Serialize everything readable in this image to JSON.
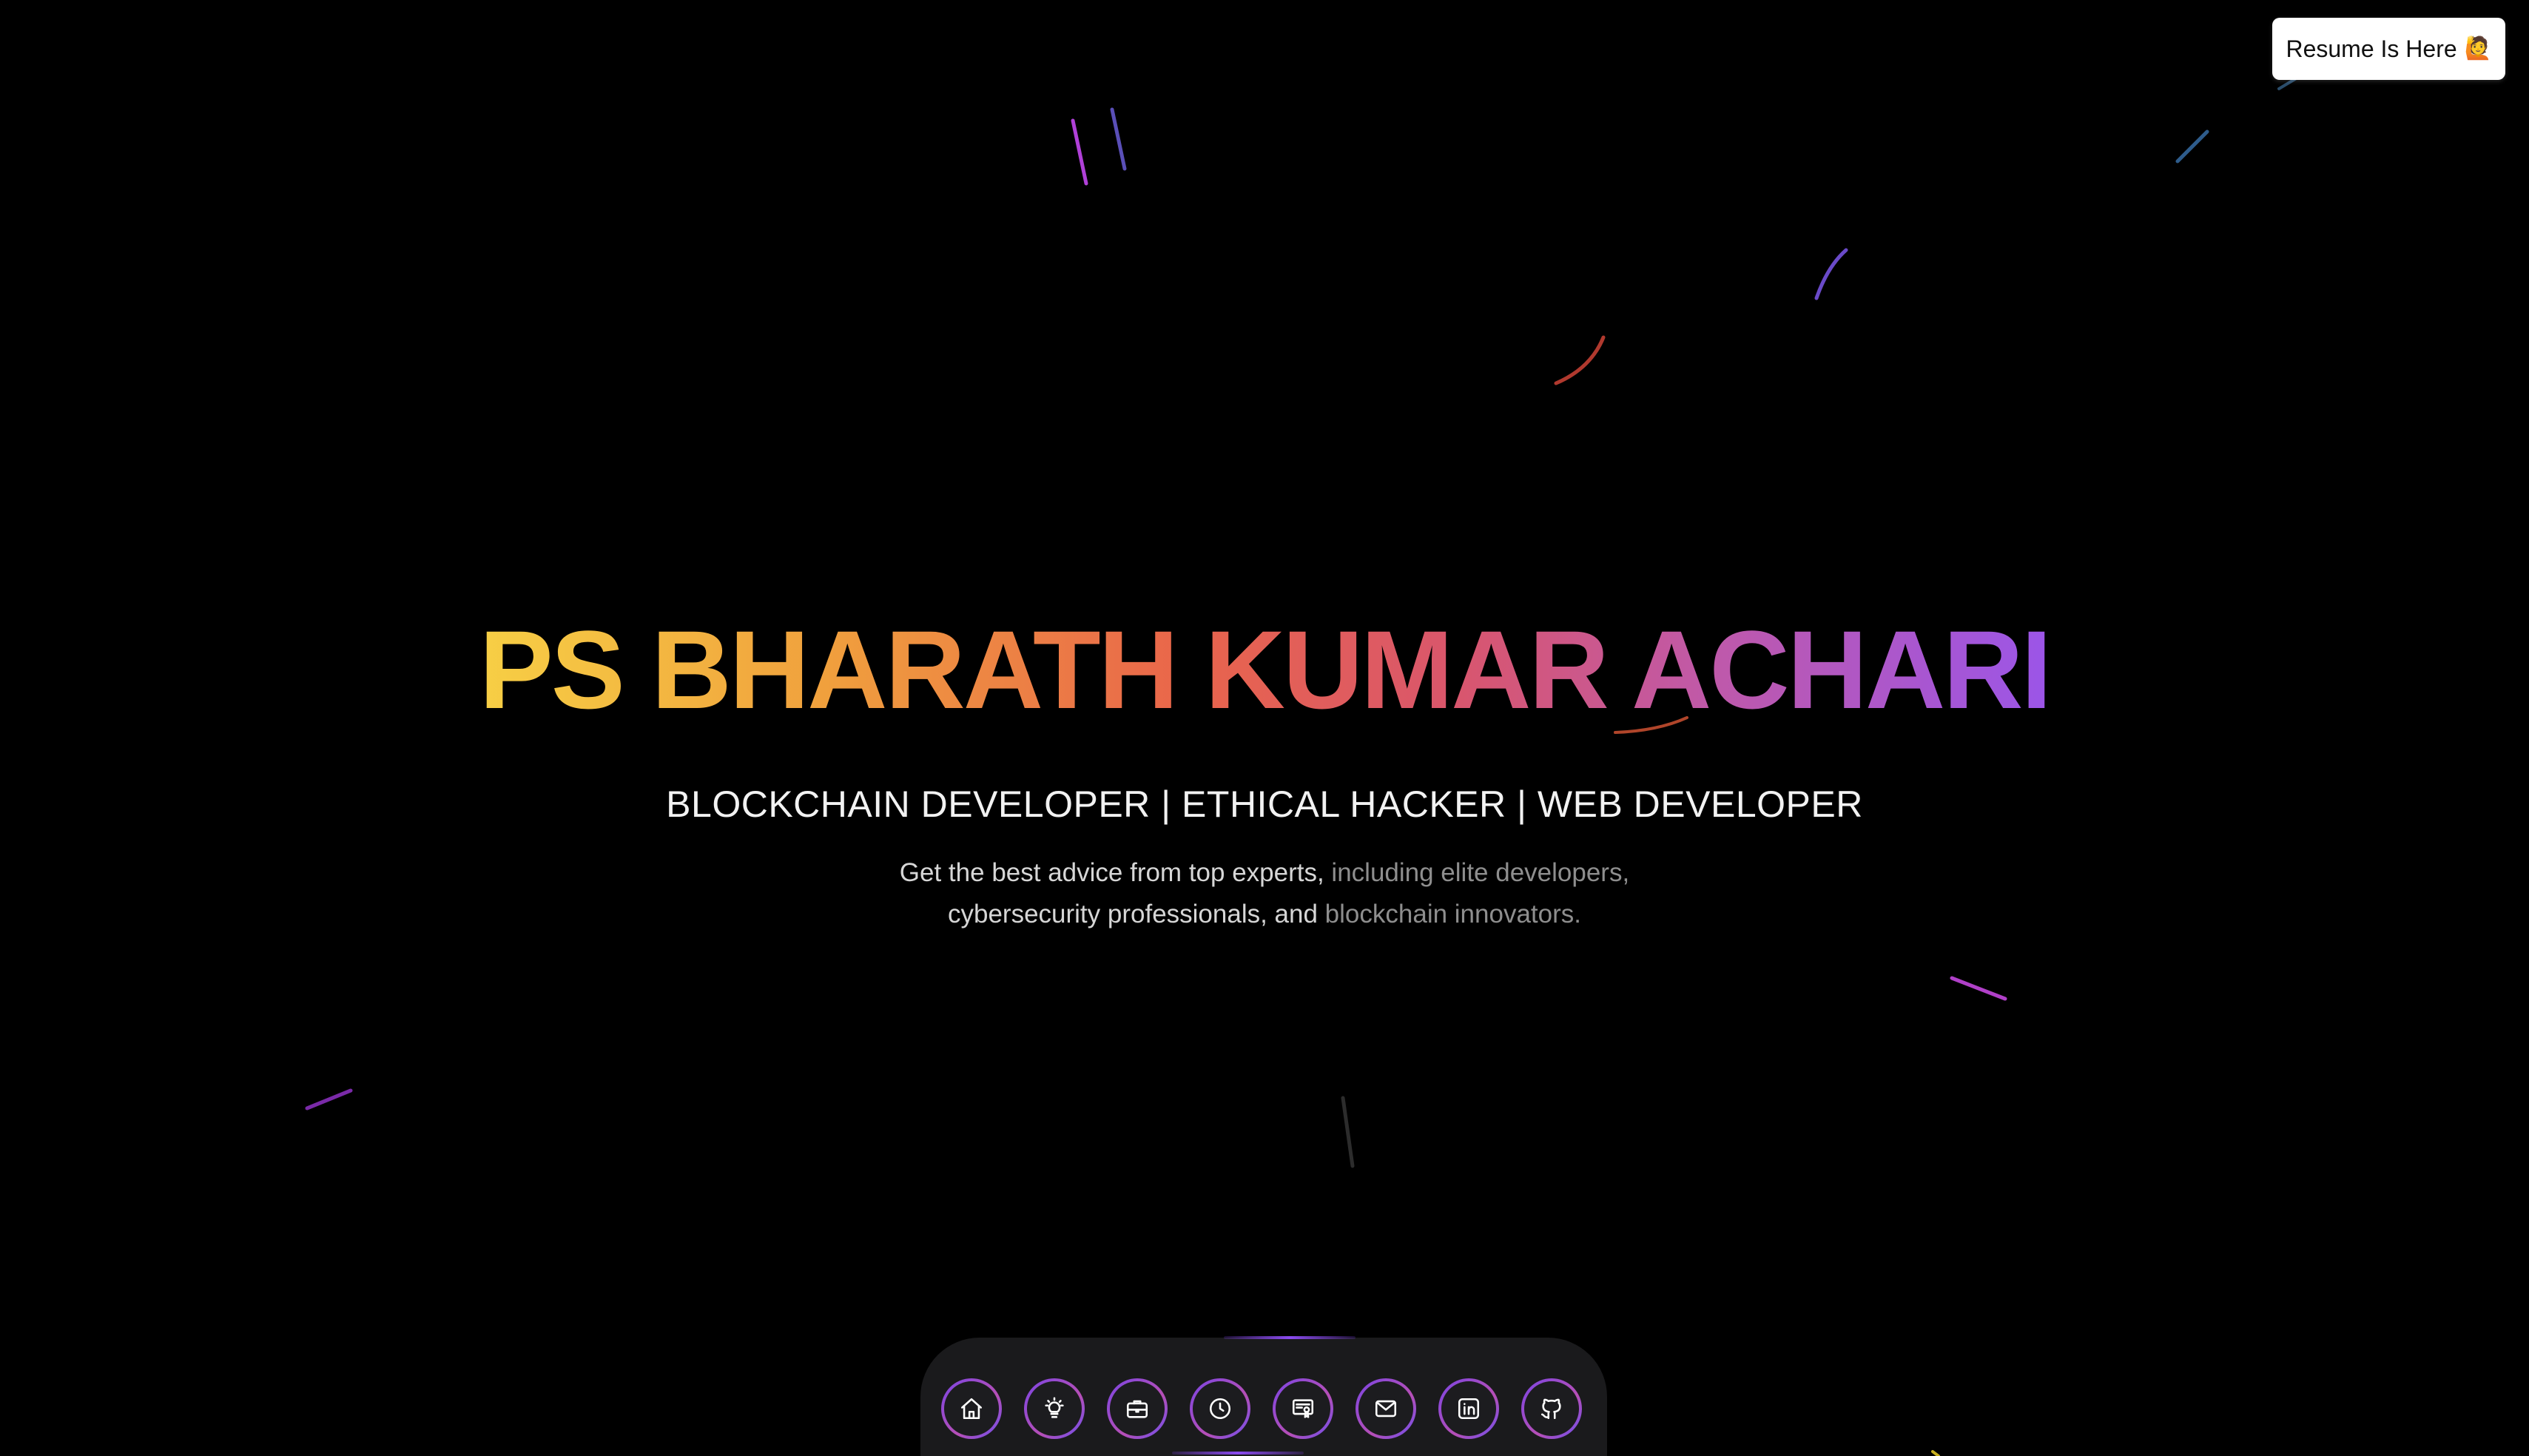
{
  "resume_button": {
    "label": "Resume Is Here",
    "emoji": "🙋"
  },
  "hero": {
    "title": "PS BHARATH KUMAR ACHARI",
    "subtitle": "BLOCKCHAIN DEVELOPER | ETHICAL HACKER | WEB DEVELOPER",
    "desc_line1_bright": "Get the best advice from top experts,",
    "desc_line1_muted": " including elite developers,",
    "desc_line2_bright": "cybersecurity professionals, and",
    "desc_line2_muted": " blockchain innovators."
  },
  "dock": {
    "items": [
      {
        "icon": "home-icon"
      },
      {
        "icon": "lightbulb-icon"
      },
      {
        "icon": "briefcase-icon"
      },
      {
        "icon": "clock-icon"
      },
      {
        "icon": "certificate-icon"
      },
      {
        "icon": "mail-icon"
      },
      {
        "icon": "linkedin-icon"
      },
      {
        "icon": "github-icon"
      }
    ]
  },
  "colors": {
    "background": "#000000",
    "gradient_start": "#f7cf45",
    "gradient_mid": "#e9654b",
    "gradient_end": "#9b55e8",
    "dock_ring": "#8b4bf0"
  }
}
